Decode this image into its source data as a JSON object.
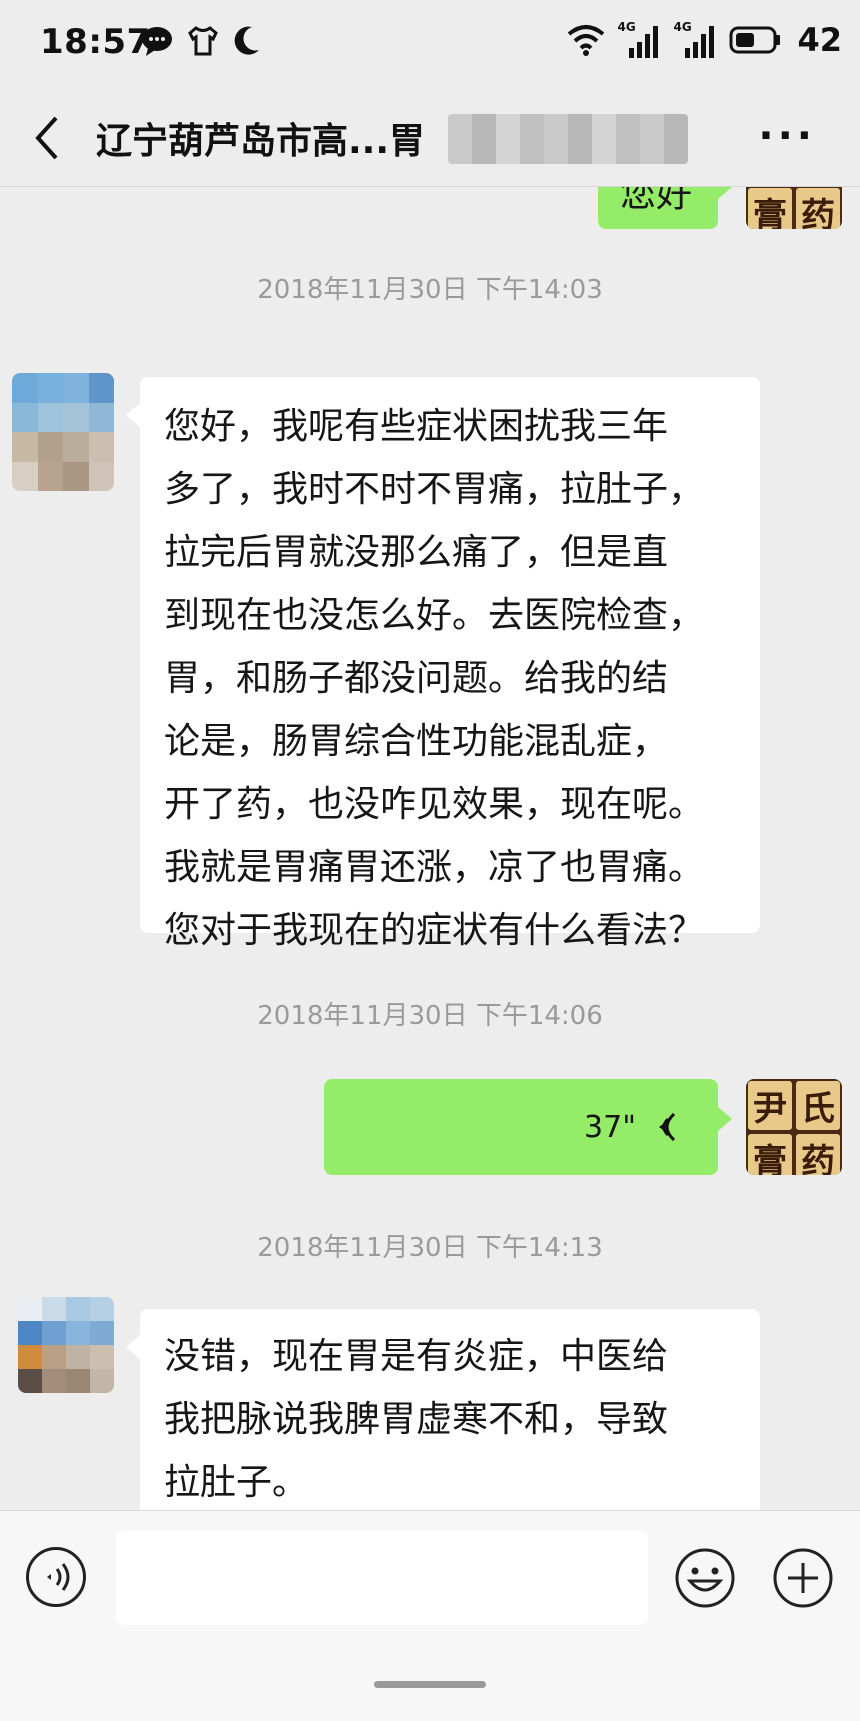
{
  "status_bar": {
    "time": "18:57",
    "net1": "4G",
    "net2": "4G",
    "battery": "42"
  },
  "header": {
    "title": "辽宁葫芦岛市高...胃",
    "more": "···"
  },
  "messages": [
    {
      "side": "out",
      "type": "text",
      "text": "您好"
    },
    {
      "type": "timestamp",
      "text": "2018年11月30日 下午14:03"
    },
    {
      "side": "in",
      "type": "text",
      "lines": [
        "您好，我呢有些症状困扰我三年",
        "多了，我时不时不胃痛，拉肚子，",
        "拉完后胃就没那么痛了，但是直",
        "到现在也没怎么好。去医院检查，",
        "胃，和肠子都没问题。给我的结",
        "论是，肠胃综合性功能混乱症，",
        "开了药，也没咋见效果，现在呢。",
        "我就是胃痛胃还涨，凉了也胃痛。",
        "您对于我现在的症状有什么看法？"
      ]
    },
    {
      "type": "timestamp",
      "text": "2018年11月30日 下午14:06"
    },
    {
      "side": "out",
      "type": "voice",
      "duration": "37\""
    },
    {
      "type": "timestamp",
      "text": "2018年11月30日 下午14:13"
    },
    {
      "side": "in",
      "type": "text",
      "lines": [
        "没错，现在胃是有炎症，中医给",
        "我把脉说我脾胃虚寒不和，导致",
        "拉肚子。"
      ]
    }
  ],
  "brand_avatar": {
    "chars": [
      "尹",
      "氏",
      "膏",
      "药"
    ]
  },
  "colors": {
    "bubble_out": "#95ec69",
    "bubble_in": "#ffffff",
    "background": "#ededed"
  }
}
